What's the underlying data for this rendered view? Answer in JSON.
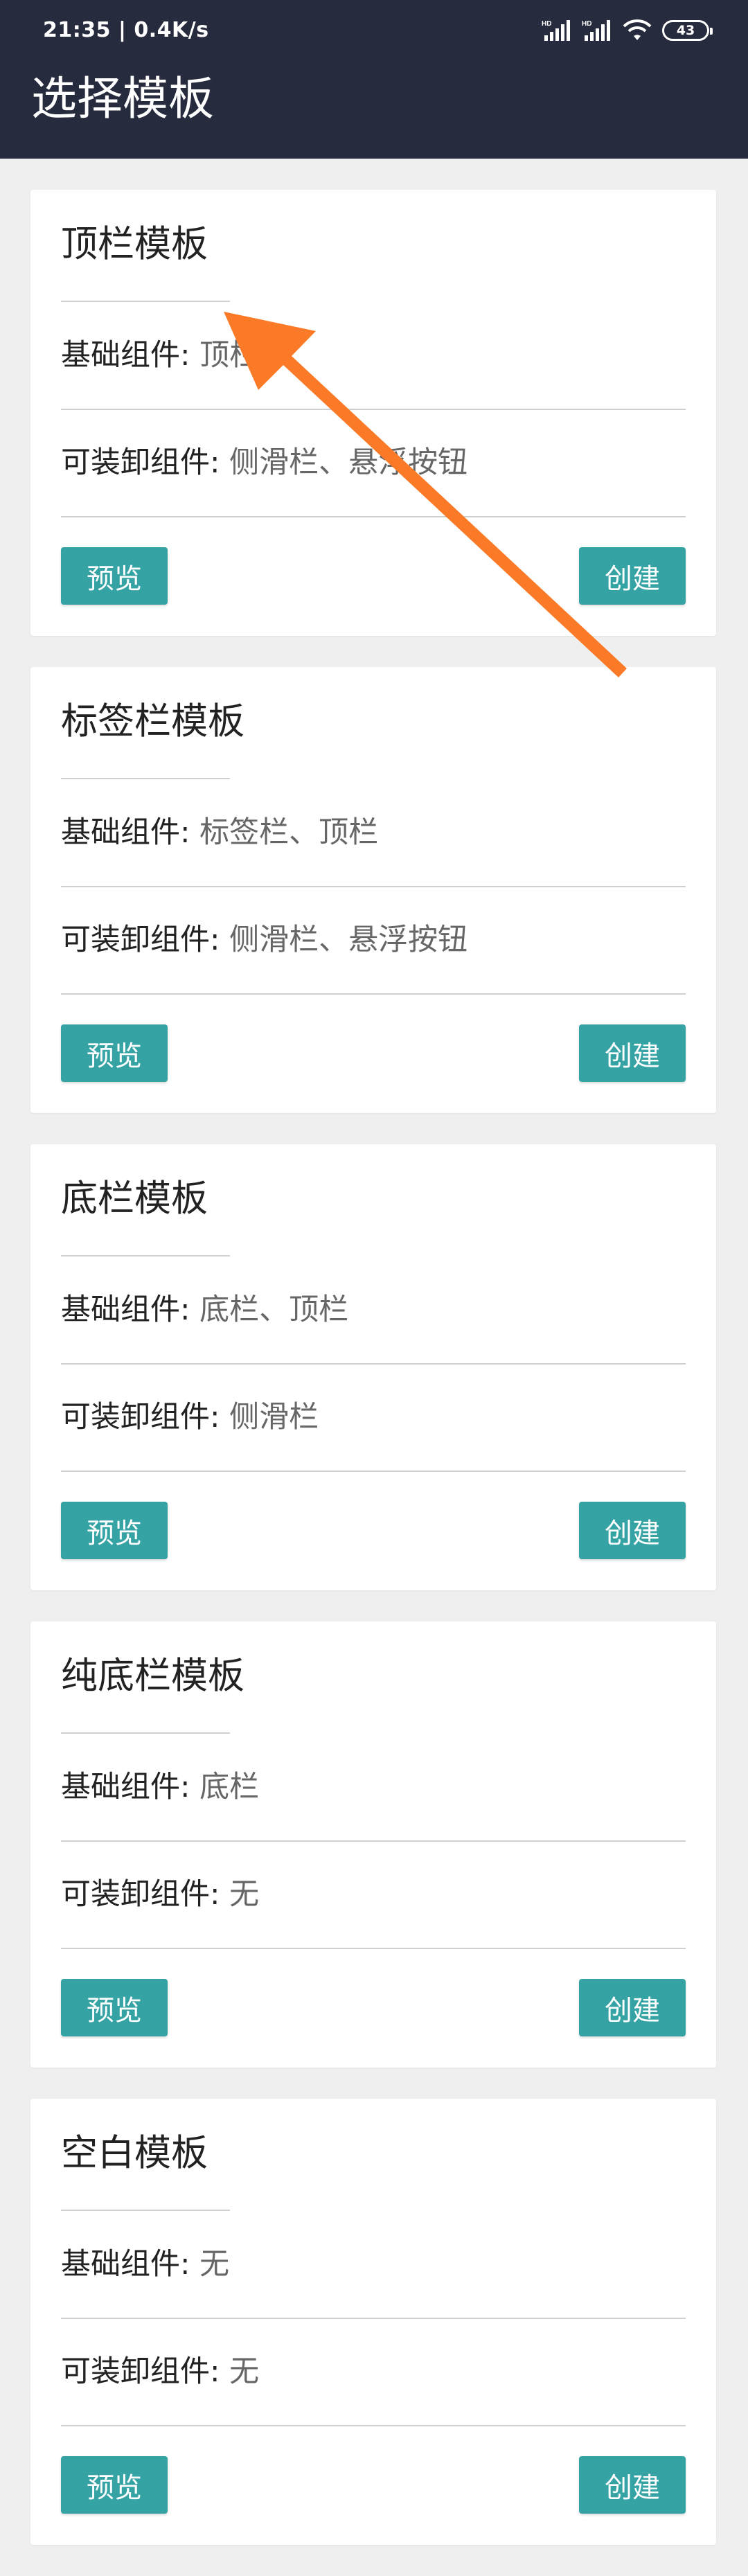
{
  "status_bar": {
    "time_speed": "21:35 | 0.4K/s",
    "signal_1_label": "HD",
    "signal_2_label": "HD",
    "battery_level": "43"
  },
  "header": {
    "title": "选择模板"
  },
  "labels": {
    "base_components": "基础组件:",
    "removable_components": "可装卸组件:",
    "preview_button": "预览",
    "create_button": "创建"
  },
  "templates": [
    {
      "name": "顶栏模板",
      "base": "顶栏",
      "removable": "侧滑栏、悬浮按钮"
    },
    {
      "name": "标签栏模板",
      "base": "标签栏、顶栏",
      "removable": "侧滑栏、悬浮按钮"
    },
    {
      "name": "底栏模板",
      "base": "底栏、顶栏",
      "removable": "侧滑栏"
    },
    {
      "name": "纯底栏模板",
      "base": "底栏",
      "removable": "无"
    },
    {
      "name": "空白模板",
      "base": "无",
      "removable": "无"
    }
  ],
  "colors": {
    "appbar": "#272b3e",
    "background": "#efefef",
    "accent_button": "#35a3a4",
    "annotation_arrow": "#fb7a27"
  }
}
